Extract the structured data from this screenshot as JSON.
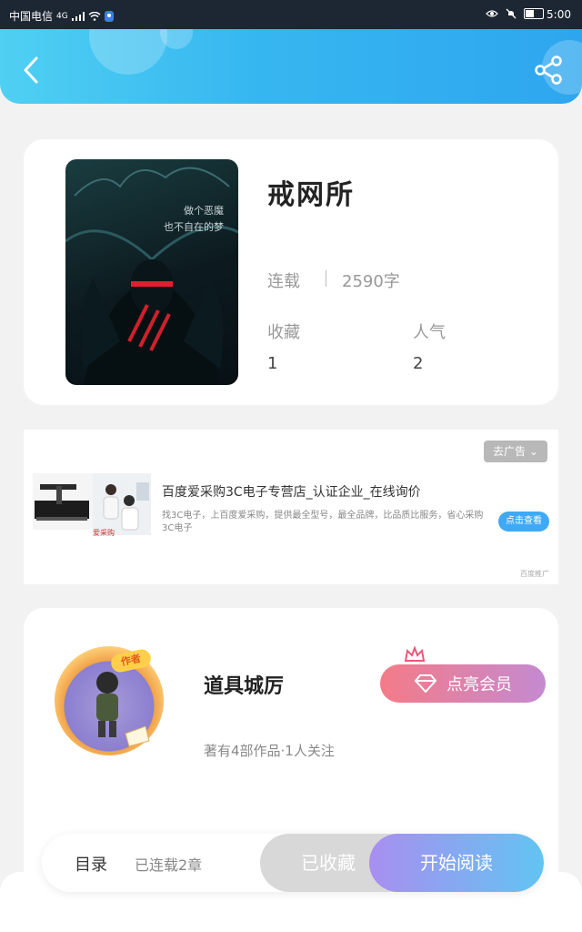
{
  "status_bar": {
    "carrier": "中国电信",
    "network": "4G",
    "time": "5:00"
  },
  "book": {
    "title": "戒网所",
    "status": "连载",
    "words": "2590字",
    "favorites_label": "收藏",
    "favorites_value": "1",
    "popularity_label": "人气",
    "popularity_value": "2",
    "cover_text_line1": "做个恶魔",
    "cover_text_line2": "也不自在的梦"
  },
  "ad": {
    "close_label": "去广告",
    "title": "百度爱采购3C电子专营店_认证企业_在线询价",
    "description": "找3C电子，上百度爱采购，提供最全型号，最全品牌，比品质比服务，省心采购3C电子",
    "cta": "点击查看",
    "tag": "百度推广",
    "logo_text": "爱采购"
  },
  "author": {
    "badge": "作者",
    "name": "道具城厉",
    "stats": "著有4部作品·1人关注",
    "vip_label": "点亮会员"
  },
  "bottom_bar": {
    "toc": "目录",
    "chapters": "已连载2章",
    "collected": "已收藏",
    "read": "开始阅读"
  }
}
